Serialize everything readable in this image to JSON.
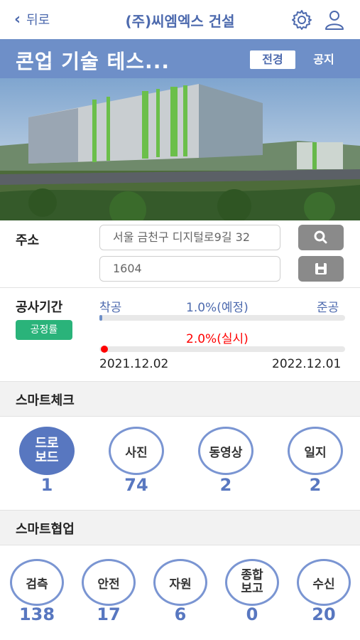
{
  "header": {
    "back_label": "뒤로",
    "company": "(주)씨엠엑스 건설"
  },
  "project": {
    "title": "콘업 기술 테스...",
    "tabs": [
      "전경",
      "공지"
    ]
  },
  "address": {
    "label": "주소",
    "line1": "서울 금천구 디지털로9길 32",
    "line2": "1604"
  },
  "schedule": {
    "label": "공사기간",
    "badge": "공정률",
    "start_label": "착공",
    "end_label": "준공",
    "planned_text": "1.0%(예정)",
    "planned_value": 1.0,
    "actual_text": "2.0%(실시)",
    "actual_value": 2.0,
    "start_date": "2021.12.02",
    "end_date": "2022.12.01"
  },
  "smart_check": {
    "title": "스마트체크",
    "items": [
      {
        "label": "드로\n보드",
        "count": "1"
      },
      {
        "label": "사진",
        "count": "74"
      },
      {
        "label": "동영상",
        "count": "2"
      },
      {
        "label": "일지",
        "count": "2"
      }
    ]
  },
  "smart_collab": {
    "title": "스마트협업",
    "items": [
      {
        "label": "검측",
        "count": "138"
      },
      {
        "label": "안전",
        "count": "17"
      },
      {
        "label": "자원",
        "count": "6"
      },
      {
        "label": "종합\n보고",
        "count": "0"
      },
      {
        "label": "수신",
        "count": "20"
      }
    ]
  },
  "colors": {
    "primary": "#6e8fc8",
    "accent": "#5877c0",
    "badge": "#2ab37a",
    "actual": "#ff0000"
  },
  "icons": [
    "chevron-left-icon",
    "gear-icon",
    "user-icon",
    "search-icon",
    "save-icon"
  ]
}
